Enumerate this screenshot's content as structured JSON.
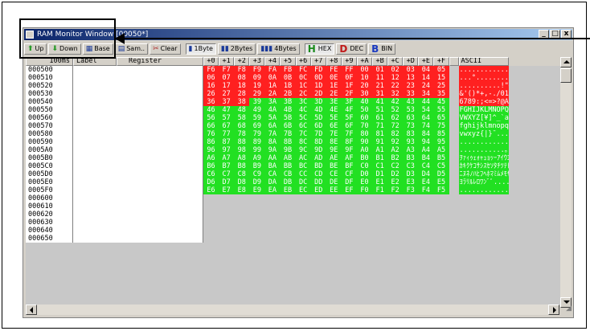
{
  "window": {
    "title": "RAM Monitor Window [00050*]"
  },
  "window_buttons": {
    "minimize": "_",
    "maximize": "□",
    "close": "x"
  },
  "toolbar": {
    "up_label": "Up",
    "down_label": "Down",
    "base_label": "Base",
    "sam_label": "Sam..",
    "clear_label": "Clear",
    "byte1_label": "1Byte",
    "byte2_label": "2Bytes",
    "byte4_label": "4Bytes",
    "hex_label": "HEX",
    "dec_label": "DEC",
    "bin_label": "BIN",
    "hex_glyph": "H",
    "dec_glyph": "D",
    "bin_glyph": "B"
  },
  "header": {
    "interval": "100ms",
    "label": "Label",
    "register": "Register",
    "columns": [
      "+0",
      "+1",
      "+2",
      "+3",
      "+4",
      "+5",
      "+6",
      "+7",
      "+8",
      "+9",
      "+A",
      "+B",
      "+C",
      "+D",
      "+E",
      "+F"
    ],
    "ascii": "ASCII"
  },
  "colors": {
    "changed": "#ff2020",
    "read": "#22e022",
    "unaccessed": "#c8c8c8",
    "title_bar": "#0a246a"
  },
  "rows": [
    {
      "addr": "000500",
      "bytes": [
        "F6",
        "F7",
        "F8",
        "F9",
        "FA",
        "FB",
        "FC",
        "FD",
        "FE",
        "FF",
        "00",
        "01",
        "02",
        "03",
        "04",
        "05"
      ],
      "ascii": "............",
      "red_from": 0,
      "green_from": 16
    },
    {
      "addr": "000510",
      "bytes": [
        "06",
        "07",
        "08",
        "09",
        "0A",
        "0B",
        "0C",
        "0D",
        "0E",
        "0F",
        "10",
        "11",
        "12",
        "13",
        "14",
        "15"
      ],
      "ascii": "...°...........",
      "red_from": 0,
      "green_from": 16
    },
    {
      "addr": "000520",
      "bytes": [
        "16",
        "17",
        "18",
        "19",
        "1A",
        "1B",
        "1C",
        "1D",
        "1E",
        "1F",
        "20",
        "21",
        "22",
        "23",
        "24",
        "25"
      ],
      "ascii": "..........!\"#$%",
      "red_from": 0,
      "green_from": 16
    },
    {
      "addr": "000530",
      "bytes": [
        "26",
        "27",
        "28",
        "29",
        "2A",
        "2B",
        "2C",
        "2D",
        "2E",
        "2F",
        "30",
        "31",
        "32",
        "33",
        "34",
        "35"
      ],
      "ascii": "&'()*+,-./012345",
      "red_from": 0,
      "green_from": 16
    },
    {
      "addr": "000540",
      "bytes": [
        "36",
        "37",
        "38",
        "39",
        "3A",
        "3B",
        "3C",
        "3D",
        "3E",
        "3F",
        "40",
        "41",
        "42",
        "43",
        "44",
        "45"
      ],
      "ascii": "6789:;<=>?@ABCDE",
      "red_from": 0,
      "green_from": 3
    },
    {
      "addr": "000550",
      "bytes": [
        "46",
        "47",
        "48",
        "49",
        "4A",
        "4B",
        "4C",
        "4D",
        "4E",
        "4F",
        "50",
        "51",
        "52",
        "53",
        "54",
        "55"
      ],
      "ascii": "FGHIJKLMNOPQRSTU",
      "red_from": 16,
      "green_from": 0
    },
    {
      "addr": "000560",
      "bytes": [
        "56",
        "57",
        "58",
        "59",
        "5A",
        "5B",
        "5C",
        "5D",
        "5E",
        "5F",
        "60",
        "61",
        "62",
        "63",
        "64",
        "65"
      ],
      "ascii": "VWXYZ[¥]^_`abcde",
      "red_from": 16,
      "green_from": 0
    },
    {
      "addr": "000570",
      "bytes": [
        "66",
        "67",
        "68",
        "69",
        "6A",
        "6B",
        "6C",
        "6D",
        "6E",
        "6F",
        "70",
        "71",
        "72",
        "73",
        "74",
        "75"
      ],
      "ascii": "fghijklmnopqrstu",
      "red_from": 16,
      "green_from": 0
    },
    {
      "addr": "000580",
      "bytes": [
        "76",
        "77",
        "78",
        "79",
        "7A",
        "7B",
        "7C",
        "7D",
        "7E",
        "7F",
        "80",
        "81",
        "82",
        "83",
        "84",
        "85"
      ],
      "ascii": "vwxyz{|}¯.......",
      "red_from": 16,
      "green_from": 0
    },
    {
      "addr": "000590",
      "bytes": [
        "86",
        "87",
        "88",
        "89",
        "8A",
        "8B",
        "8C",
        "8D",
        "8E",
        "8F",
        "90",
        "91",
        "92",
        "93",
        "94",
        "95"
      ],
      "ascii": "................",
      "red_from": 16,
      "green_from": 0
    },
    {
      "addr": "0005A0",
      "bytes": [
        "96",
        "97",
        "98",
        "99",
        "9A",
        "9B",
        "9C",
        "9D",
        "9E",
        "9F",
        "A0",
        "A1",
        "A2",
        "A3",
        "A4",
        "A5"
      ],
      "ascii": "...........｡｢｣､･",
      "red_from": 16,
      "green_from": 0
    },
    {
      "addr": "0005B0",
      "bytes": [
        "A6",
        "A7",
        "A8",
        "A9",
        "AA",
        "AB",
        "AC",
        "AD",
        "AE",
        "AF",
        "B0",
        "B1",
        "B2",
        "B3",
        "B4",
        "B5"
      ],
      "ascii": "ｦｧｨｩｪｫｬｭｮｯｰｱｲｳｴｵ",
      "red_from": 16,
      "green_from": 0
    },
    {
      "addr": "0005C0",
      "bytes": [
        "B6",
        "B7",
        "B8",
        "B9",
        "BA",
        "BB",
        "BC",
        "BD",
        "BE",
        "BF",
        "C0",
        "C1",
        "C2",
        "C3",
        "C4",
        "C5"
      ],
      "ascii": "ｶｷｸｹｺｻｼｽｾｿﾀﾁﾂﾃﾄﾅ",
      "red_from": 16,
      "green_from": 0
    },
    {
      "addr": "0005D0",
      "bytes": [
        "C6",
        "C7",
        "C8",
        "C9",
        "CA",
        "CB",
        "CC",
        "CD",
        "CE",
        "CF",
        "D0",
        "D1",
        "D2",
        "D3",
        "D4",
        "D5"
      ],
      "ascii": "ﾆﾇﾈﾉﾊﾋﾌﾍﾎﾏﾐﾑﾒﾓﾔﾕ",
      "red_from": 16,
      "green_from": 0
    },
    {
      "addr": "0005E0",
      "bytes": [
        "D6",
        "D7",
        "D8",
        "D9",
        "DA",
        "DB",
        "DC",
        "DD",
        "DE",
        "DF",
        "E0",
        "E1",
        "E2",
        "E3",
        "E4",
        "E5"
      ],
      "ascii": "ﾖﾗﾘﾙﾚﾛﾜﾝﾞﾟ......",
      "red_from": 16,
      "green_from": 0
    },
    {
      "addr": "0005F0",
      "bytes": [
        "E6",
        "E7",
        "E8",
        "E9",
        "EA",
        "EB",
        "EC",
        "ED",
        "EE",
        "EF",
        "F0",
        "F1",
        "F2",
        "F3",
        "F4",
        "F5"
      ],
      "ascii": "................",
      "red_from": 16,
      "green_from": 0
    },
    {
      "addr": "000600",
      "bytes": [],
      "ascii": "",
      "red_from": 16,
      "green_from": 16
    },
    {
      "addr": "000610",
      "bytes": [],
      "ascii": "",
      "red_from": 16,
      "green_from": 16
    },
    {
      "addr": "000620",
      "bytes": [],
      "ascii": "",
      "red_from": 16,
      "green_from": 16
    },
    {
      "addr": "000630",
      "bytes": [],
      "ascii": "",
      "red_from": 16,
      "green_from": 16
    },
    {
      "addr": "000640",
      "bytes": [],
      "ascii": "",
      "red_from": 16,
      "green_from": 16
    },
    {
      "addr": "000650",
      "bytes": [],
      "ascii": "",
      "red_from": 16,
      "green_from": 16
    }
  ]
}
